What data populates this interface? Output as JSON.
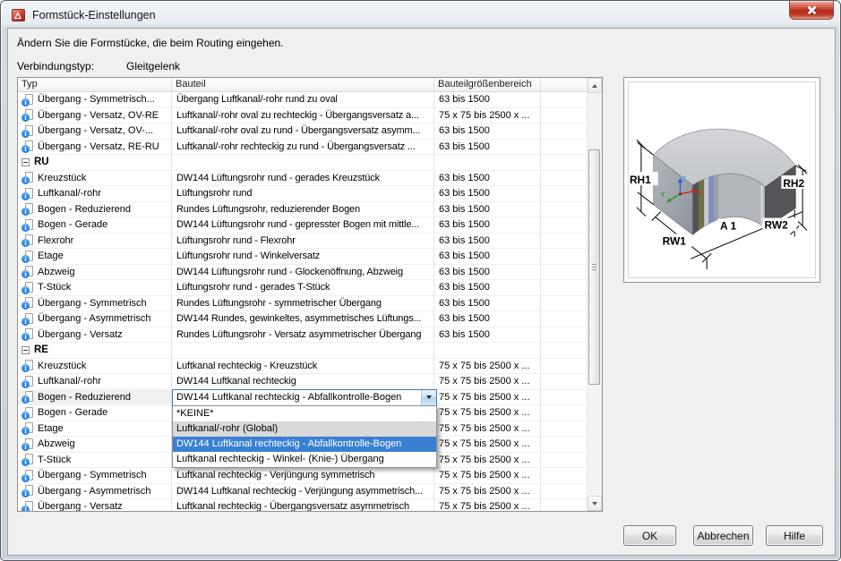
{
  "window": {
    "title": "Formstück-Einstellungen"
  },
  "description": "Ändern Sie die Formstücke, die beim Routing eingehen.",
  "connection": {
    "label": "Verbindungstyp:",
    "value": "Gleitgelenk"
  },
  "table": {
    "columns": [
      "Typ",
      "Bauteil",
      "Bauteilgrößenbereich"
    ],
    "rows": [
      {
        "kind": "item",
        "typ": "Übergang - Symmetrisch...",
        "bauteil": "Übergang Luftkanal/-rohr rund zu oval",
        "bereich": "63 bis 1500"
      },
      {
        "kind": "item",
        "typ": "Übergang - Versatz, OV-RE",
        "bauteil": "Luftkanal/-rohr oval zu rechteckig - Übergangsversatz a...",
        "bereich": "75 x 75 bis 2500 x ..."
      },
      {
        "kind": "item",
        "typ": "Übergang - Versatz, OV-...",
        "bauteil": "Luftkanal/-rohr oval zu rund - Übergangsversatz asymm...",
        "bereich": "63 bis 1500"
      },
      {
        "kind": "item",
        "typ": "Übergang - Versatz, RE-RU",
        "bauteil": "Luftkanal/-rohr rechteckig zu rund - Übergangsversatz ...",
        "bereich": "63 bis 1500"
      },
      {
        "kind": "group",
        "label": "RU"
      },
      {
        "kind": "item",
        "typ": "Kreuzstück",
        "bauteil": "DW144 Lüftungsrohr rund - gerades Kreuzstück",
        "bereich": "63 bis 1500"
      },
      {
        "kind": "item",
        "typ": "Luftkanal/-rohr",
        "bauteil": "Lüftungsrohr rund",
        "bereich": "63 bis 1500"
      },
      {
        "kind": "item",
        "typ": "Bogen - Reduzierend",
        "bauteil": "Rundes Lüftungsrohr, reduzierender Bogen",
        "bereich": "63 bis 1500"
      },
      {
        "kind": "item",
        "typ": "Bogen - Gerade",
        "bauteil": "DW144 Lüftungsrohr rund - gepresster Bogen mit mittle...",
        "bereich": "63 bis 1500"
      },
      {
        "kind": "item",
        "typ": "Flexrohr",
        "bauteil": "Lüftungsrohr rund - Flexrohr",
        "bereich": "63 bis 1500"
      },
      {
        "kind": "item",
        "typ": "Etage",
        "bauteil": "Lüftungsrohr rund - Winkelversatz",
        "bereich": "63 bis 1500"
      },
      {
        "kind": "item",
        "typ": "Abzweig",
        "bauteil": "DW144 Lüftungsrohr rund - Glockenöffnung, Abzweig",
        "bereich": "63 bis 1500"
      },
      {
        "kind": "item",
        "typ": "T-Stück",
        "bauteil": "Lüftungsrohr rund - gerades T-Stück",
        "bereich": "63 bis 1500"
      },
      {
        "kind": "item",
        "typ": "Übergang - Symmetrisch",
        "bauteil": "Rundes Lüftungsrohr - symmetrischer Übergang",
        "bereich": "63 bis 1500"
      },
      {
        "kind": "item",
        "typ": "Übergang - Asymmetrisch",
        "bauteil": "DW144 Rundes, gewinkeltes, asymmetrisches Lüftungs...",
        "bereich": "63 bis 1500"
      },
      {
        "kind": "item",
        "typ": "Übergang - Versatz",
        "bauteil": "Rundes Lüftungsrohr - Versatz asymmetrischer Übergang",
        "bereich": "63 bis 1500"
      },
      {
        "kind": "group",
        "label": "RE"
      },
      {
        "kind": "item",
        "typ": "Kreuzstück",
        "bauteil": "Luftkanal rechteckig - Kreuzstück",
        "bereich": "75 x 75 bis 2500 x ..."
      },
      {
        "kind": "item",
        "typ": "Luftkanal/-rohr",
        "bauteil": "DW144 Luftkanal rechteckig",
        "bereich": "75 x 75 bis 2500 x ..."
      },
      {
        "kind": "combo",
        "typ": "Bogen - Reduzierend",
        "bauteil": "",
        "bereich": "75 x 75 bis 2500 x ..."
      },
      {
        "kind": "item",
        "typ": "Bogen - Gerade",
        "bauteil": "",
        "bereich": "75 x 75 bis 2500 x ..."
      },
      {
        "kind": "item",
        "typ": "Etage",
        "bauteil": "",
        "bereich": "75 x 75 bis 2500 x ..."
      },
      {
        "kind": "item",
        "typ": "Abzweig",
        "bauteil": "",
        "bereich": "75 x 75 bis 2500 x ..."
      },
      {
        "kind": "item",
        "typ": "T-Stück",
        "bauteil": "",
        "bereich": "75 x 75 bis 2500 x ..."
      },
      {
        "kind": "item",
        "typ": "Übergang - Symmetrisch",
        "bauteil": "Luftkanal rechteckig - Verjüngung symmetrisch",
        "bereich": "75 x 75 bis 2500 x ..."
      },
      {
        "kind": "item",
        "typ": "Übergang - Asymmetrisch",
        "bauteil": "DW144 Luftkanal rechteckig - Verjüngung asymmetrisch...",
        "bereich": "75 x 75 bis 2500 x ..."
      },
      {
        "kind": "item",
        "typ": "Übergang - Versatz",
        "bauteil": "Luftkanal rechteckig - Übergangsversatz asymmetrisch",
        "bereich": "75 x 75 bis 2500 x ..."
      }
    ]
  },
  "combobox": {
    "value": "DW144 Luftkanal rechteckig - Abfallkontrolle-Bogen"
  },
  "dropdown": {
    "items": [
      {
        "label": "*KEINE*",
        "state": "normal"
      },
      {
        "label": "Luftkanal/-rohr (Global)",
        "state": "dimmed"
      },
      {
        "label": "DW144 Luftkanal rechteckig - Abfallkontrolle-Bogen",
        "state": "selected"
      },
      {
        "label": "Luftkanal rechteckig - Winkel- (Knie-) Übergang",
        "state": "normal"
      }
    ]
  },
  "preview": {
    "labels": {
      "rh1": "RH1",
      "rh2": "RH2",
      "a1": "A 1",
      "rw1": "RW1",
      "rw2": "RW2"
    },
    "axes": {
      "x": "x",
      "y": "Y",
      "z": "z"
    }
  },
  "buttons": {
    "ok": "OK",
    "cancel": "Abbrechen",
    "help": "Hilfe"
  },
  "icons": {
    "info_glyph": "i"
  },
  "colors": {
    "accent_selection": "#3a80d2",
    "combobox_border": "#3c7fb1",
    "close_button_red": "#b52a17",
    "icon_info_blue": "#1e78d7",
    "client_background": "#f0f0f0"
  }
}
